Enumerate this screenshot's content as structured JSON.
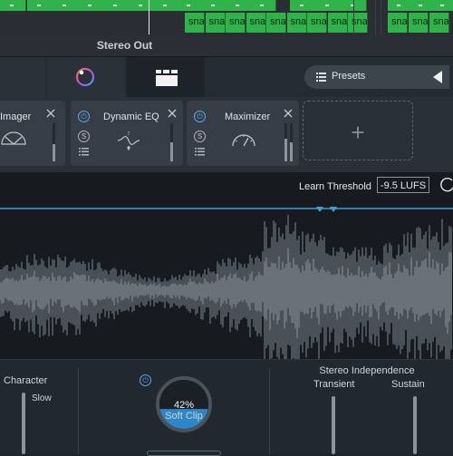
{
  "daw": {
    "region_label": "sna",
    "region_count": 9,
    "region_count_right": 3,
    "channel_title": "Stereo Out"
  },
  "nav": {
    "presets_label": "Presets"
  },
  "modules": [
    {
      "title": "Imager",
      "icon": "imager-icon",
      "meter_level": 0.45
    },
    {
      "title": "Dynamic EQ",
      "icon": "dynamic-eq-icon",
      "meter_level": 0.5
    },
    {
      "title": "Maximizer",
      "icon": "maximizer-icon",
      "meter_level": 0.6
    }
  ],
  "module_buttons": {
    "solo": "S"
  },
  "threshold": {
    "learn_label": "Learn Threshold",
    "value": "-9.5 LUFS"
  },
  "bottom": {
    "character_label": "Character",
    "slow_label": "Slow",
    "soft_clip_value": "42%",
    "soft_clip_level": 0.42,
    "soft_clip_label": "Soft Clip",
    "stereo_independence_label": "Stereo Independence",
    "transient_label": "Transient",
    "sustain_label": "Sustain"
  },
  "colors": {
    "region_green": "#2fb34a",
    "accent_blue": "#4aa3e0",
    "panel_bg": "#222830"
  }
}
